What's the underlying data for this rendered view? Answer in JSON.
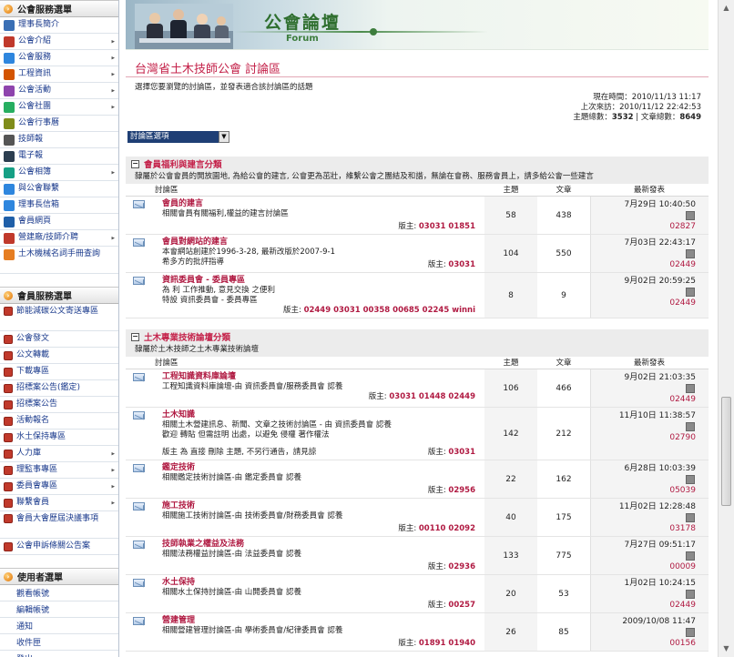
{
  "sidebar": {
    "sections": [
      {
        "title": "公會服務選單",
        "items": [
          {
            "label": "理事長簡介",
            "icon": "person-icon",
            "color": "#3a6fb5",
            "arrow": false
          },
          {
            "label": "公會介紹",
            "icon": "building-icon",
            "color": "#c0392b",
            "arrow": true
          },
          {
            "label": "公會服務",
            "icon": "globe-icon",
            "color": "#2e86de",
            "arrow": true
          },
          {
            "label": "工程資訊",
            "icon": "puzzle-icon",
            "color": "#d35400",
            "arrow": true
          },
          {
            "label": "公會活動",
            "icon": "people-icon",
            "color": "#8e44ad",
            "arrow": true
          },
          {
            "label": "公會社團",
            "icon": "group-icon",
            "color": "#27ae60",
            "arrow": true
          },
          {
            "label": "公會行事曆",
            "icon": "calendar-icon",
            "color": "#7f8c1a",
            "arrow": false
          },
          {
            "label": "技師報",
            "icon": "newspaper-icon",
            "color": "#555555",
            "arrow": false
          },
          {
            "label": "電子報",
            "icon": "enewspaper-icon",
            "color": "#2c3e50",
            "arrow": false
          },
          {
            "label": "公會相簿",
            "icon": "album-icon",
            "color": "#16a085",
            "arrow": true
          },
          {
            "label": "與公會聯繫",
            "icon": "mail-icon",
            "color": "#2e86de",
            "arrow": false
          },
          {
            "label": "理事長信箱",
            "icon": "mailbox-icon",
            "color": "#2e86de",
            "arrow": false
          },
          {
            "label": "會員網頁",
            "icon": "web-icon",
            "color": "#1f5fa8",
            "arrow": false
          },
          {
            "label": "營建廠/技師介聘",
            "icon": "hire-icon",
            "color": "#c0392b",
            "arrow": true
          },
          {
            "label": "土木機械名詞手冊查詢",
            "icon": "book-icon",
            "color": "#e67e22",
            "arrow": false,
            "tall": true
          }
        ]
      },
      {
        "title": "會員服務選單",
        "items": [
          {
            "label": "節能減碳公文寄送專區",
            "arrow": false,
            "tall": true
          },
          {
            "label": "公會發文",
            "arrow": false
          },
          {
            "label": "公文轉載",
            "arrow": false
          },
          {
            "label": "下載專區",
            "arrow": false
          },
          {
            "label": "招標案公告(鑑定)",
            "arrow": false
          },
          {
            "label": "招標案公告",
            "arrow": false
          },
          {
            "label": "活動報名",
            "arrow": false
          },
          {
            "label": "水土保持專區",
            "arrow": false
          },
          {
            "label": "人力庫",
            "arrow": true
          },
          {
            "label": "理監事專區",
            "arrow": true
          },
          {
            "label": "委員會專區",
            "arrow": true
          },
          {
            "label": "聯繫會員",
            "arrow": true
          },
          {
            "label": "會員大會歷屆決議事項",
            "arrow": false,
            "tall": true
          },
          {
            "label": "公會申訴條關公告案",
            "arrow": false
          }
        ]
      },
      {
        "title": "使用者選單",
        "items": [
          {
            "label": "觀看帳號"
          },
          {
            "label": "編輯帳號"
          },
          {
            "label": "通知"
          },
          {
            "label": "收件匣"
          },
          {
            "label": "登出"
          }
        ]
      }
    ]
  },
  "banner": {
    "title_cn": "公會論壇",
    "title_en": "Forum"
  },
  "forum": {
    "title": "台灣省土木技師公會 討論區",
    "description": "選擇您要瀏覽的討論區，並發表適合該討論區的話題",
    "now_label": "現在時間：2010/11/13 11:17",
    "last_visit_label": "上次來訪：2010/11/12 22:42:53",
    "total_topics_label": "主題總數：",
    "total_topics": "3532",
    "total_posts_label": "文章總數：",
    "total_posts": "8649",
    "selector_label": "討論區選項"
  },
  "columns": {
    "forum": "討論區",
    "topics": "主題",
    "posts": "文章",
    "last": "最新發表"
  },
  "categories": [
    {
      "title": "會員福利與建言分類",
      "description": "隸屬於公會會員的開放園地, 為給公會的建言, 公會更為茁壯，維繫公會之團結及和諧，無論在會務、服務會員上，請多給公會一些建言",
      "forums": [
        {
          "name": "會員的建言",
          "lines": [
            "相關會員有關福利,權益的建言討論區"
          ],
          "mod_label": "版主:",
          "mods": "03031 01851",
          "mod_inline": true,
          "topics": "58",
          "posts": "438",
          "last_date": "7月29日 10:40:50",
          "last_user": "02827"
        },
        {
          "name": "會員對網站的建言",
          "lines": [
            "本會網站創建於1996-3-28, 最新改版於2007-9-1",
            "希多方的批評指導"
          ],
          "mod_label": "版主:",
          "mods": "03031",
          "mod_inline": true,
          "topics": "104",
          "posts": "550",
          "last_date": "7月03日 22:43:17",
          "last_user": "02449"
        },
        {
          "name": "資訊委員會 - 委員專區",
          "lines": [
            "為 利 工作推動, 意見交換 之便利",
            "特設 資訊委員會 - 委員專區"
          ],
          "mod_label": "版主:",
          "mods": "02449 03031 00358 00685 02245 winni",
          "mod_inline": false,
          "topics": "8",
          "posts": "9",
          "last_date": "9月02日 20:59:25",
          "last_user": "02449"
        }
      ]
    },
    {
      "title": "土木專業技術論壇分類",
      "description": "隸屬於土木技師之土木專業技術論壇",
      "forums": [
        {
          "name": "工程知識資料庫論壇",
          "lines": [
            "工程知識資料庫論壇-由 資訊委員會/服務委員會 認養"
          ],
          "mod_label": "版主:",
          "mods": "03031 01448 02449",
          "mod_inline": false,
          "topics": "106",
          "posts": "466",
          "last_date": "9月02日 21:03:35",
          "last_user": "02449"
        },
        {
          "name": "土木知識",
          "lines": [
            "相關土木營建訊息、新聞、文章之技術討論區 - 由 資訊委員會 認養",
            "歡迎 轉貼 但需註明 出處，以避免 侵權 著作權法",
            "",
            "版主 為 直接 刪除 主題, 不另行通告，請見諒"
          ],
          "mod_label": "版主:",
          "mods": "03031",
          "mod_inline": true,
          "topics": "142",
          "posts": "212",
          "last_date": "11月10日 11:38:57",
          "last_user": "02790"
        },
        {
          "name": "鑑定技術",
          "lines": [
            "相關鑑定技術討論區-由 鑑定委員會 認養"
          ],
          "mod_label": "版主:",
          "mods": "02956",
          "mod_inline": true,
          "topics": "22",
          "posts": "162",
          "last_date": "6月28日 10:03:39",
          "last_user": "05039"
        },
        {
          "name": "施工技術",
          "lines": [
            "相關施工技術討論區-由 技術委員會/財務委員會 認養"
          ],
          "mod_label": "版主:",
          "mods": "00110 02092",
          "mod_inline": true,
          "topics": "40",
          "posts": "175",
          "last_date": "11月02日 12:28:48",
          "last_user": "03178"
        },
        {
          "name": "技師執業之權益及法務",
          "lines": [
            "相關法務權益討論區-由 法益委員會 認養"
          ],
          "mod_label": "版主:",
          "mods": "02936",
          "mod_inline": true,
          "topics": "133",
          "posts": "775",
          "last_date": "7月27日 09:51:17",
          "last_user": "00009"
        },
        {
          "name": "水土保持",
          "lines": [
            "相關水土保持討論區-由 山開委員會 認養"
          ],
          "mod_label": "版主:",
          "mods": "00257",
          "mod_inline": true,
          "topics": "20",
          "posts": "53",
          "last_date": "1月02日 10:24:15",
          "last_user": "02449"
        },
        {
          "name": "營建管理",
          "lines": [
            "相關營建管理討論區-由 學術委員會/紀律委員會 認養"
          ],
          "mod_label": "版主:",
          "mods": "01891 01940",
          "mod_inline": true,
          "topics": "26",
          "posts": "85",
          "last_date": "2009/10/08 11:47",
          "last_user": "00156"
        }
      ]
    }
  ]
}
